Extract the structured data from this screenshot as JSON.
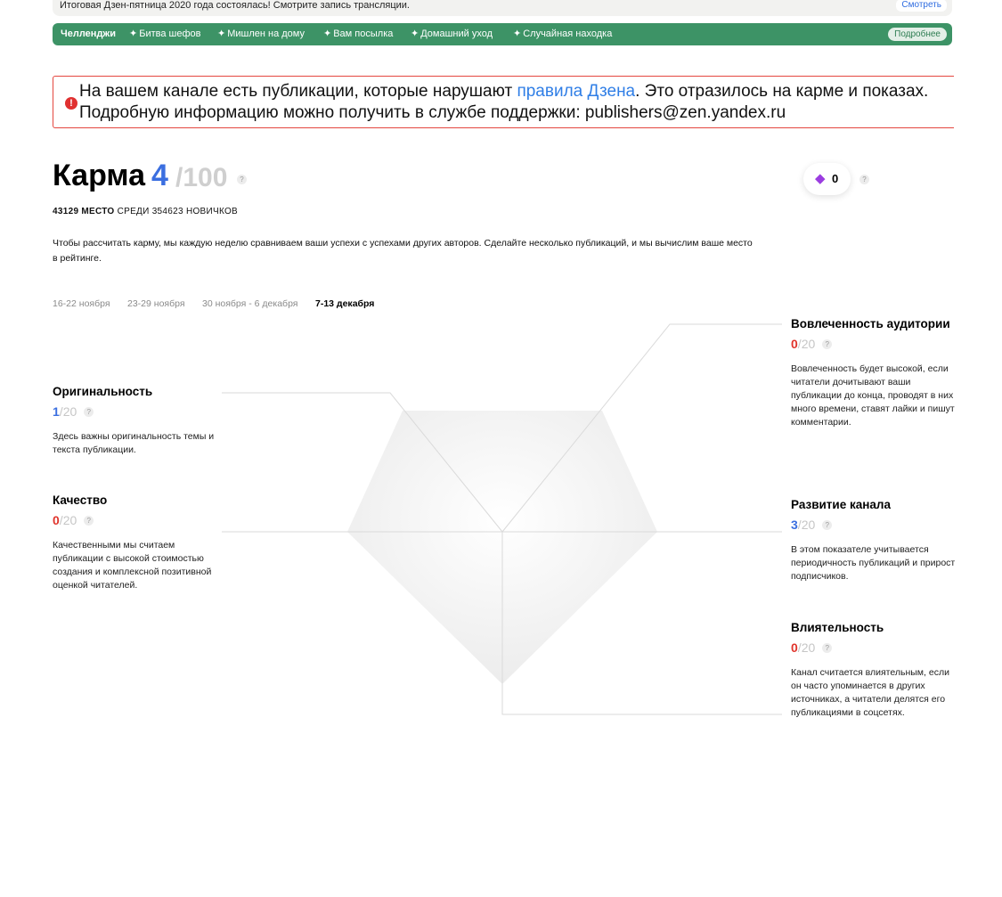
{
  "banner": {
    "text": "Итоговая Дзен-пятница 2020 года состоялась! Смотрите запись трансляции.",
    "watch_label": "Смотреть"
  },
  "challenges": {
    "title": "Челленджи",
    "items": [
      "Битва шефов",
      "Мишлен на дому",
      "Вам посылка",
      "Домашний уход",
      "Случайная находка"
    ],
    "more_label": "Подробнее",
    "bar_color": "#3d9366"
  },
  "alert": {
    "text_before": "На вашем канале есть публикации, которые нарушают ",
    "link": "правила Дзена",
    "text_after": ". Это отразилось на карме и показах. Подробную информацию можно получить в службе поддержки: publishers@zen.yandex.ru",
    "icon": "exclamation-icon"
  },
  "karma": {
    "title": "Карма",
    "value": "4",
    "max": "/100",
    "gems": "0",
    "place_number": "43129 МЕСТО",
    "place_rest": "СРЕДИ 354623 НОВИЧКОВ",
    "description": "Чтобы рассчитать карму, мы каждую неделю сравниваем ваши успехи с успехами других авторов. Сделайте несколько публикаций, и мы вычислим ваше место в рейтинге."
  },
  "weeks": [
    {
      "label": "16-22 ноября",
      "active": false
    },
    {
      "label": "23-29 ноября",
      "active": false
    },
    {
      "label": "30 ноября - 6 декабря",
      "active": false
    },
    {
      "label": "7-13 декабря",
      "active": true
    }
  ],
  "metrics": {
    "originality": {
      "title": "Оригинальность",
      "value": "1",
      "max": "20",
      "desc": "Здесь важны оригинальность темы и текста публикации."
    },
    "quality": {
      "title": "Качество",
      "value": "0",
      "max": "20",
      "desc": "Качественными мы считаем публикации с высокой стоимостью создания и комплексной позитивной оценкой читателей."
    },
    "engagement": {
      "title": "Вовлеченность аудитории",
      "value": "0",
      "max": "20",
      "desc": "Вовлеченность будет высокой, если читатели дочитывают ваши публикации до конца, проводят в них много времени, ставят лайки и пишут комментарии."
    },
    "growth": {
      "title": "Развитие канала",
      "value": "3",
      "max": "20",
      "desc": "В этом показателе учитывается периодичность публикаций и прирост подписчиков."
    },
    "influence": {
      "title": "Влиятельность",
      "value": "0",
      "max": "20",
      "desc": "Канал считается влиятельным, если он часто упоминается в других источниках, а читатели делятся его публикациями в соцсетях."
    }
  },
  "help_mark": "?",
  "slash": "/",
  "colors": {
    "accent_blue": "#3b6fe0",
    "alert_red": "#e4473f",
    "zero_red": "#e0342c",
    "gem_purple": "#9b3de0"
  }
}
